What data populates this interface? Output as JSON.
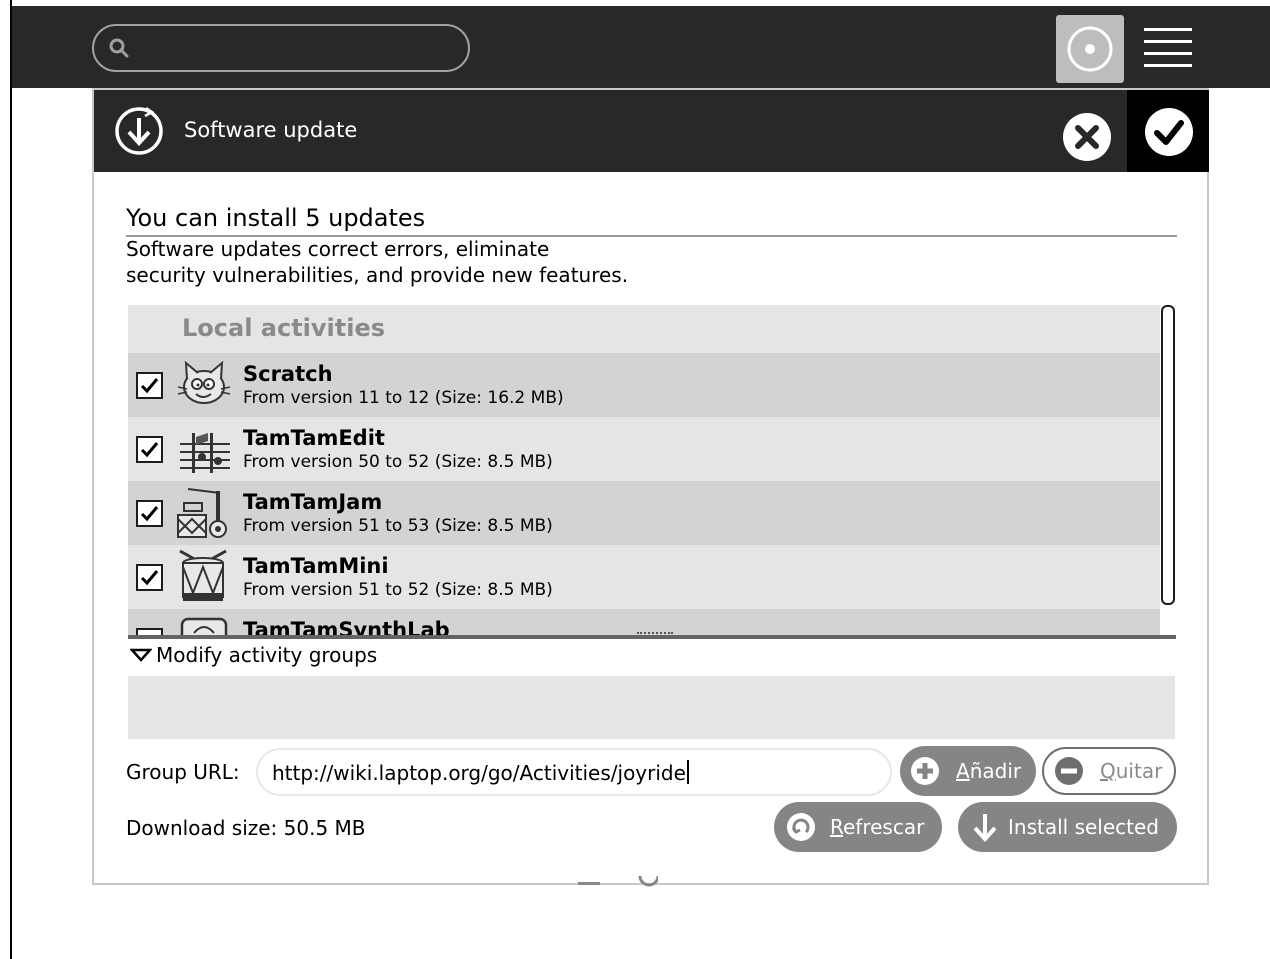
{
  "toolbar": {
    "search_placeholder": "",
    "home_icon": "home-ring-icon",
    "list_icon": "list-view-icon"
  },
  "dialog": {
    "title": "Software update",
    "headline": "You can install 5 updates",
    "description_line1": "Software updates correct errors, eliminate",
    "description_line2": "security vulnerabilities, and provide new features.",
    "group_header": "Local activities",
    "activities": [
      {
        "name": "Scratch",
        "version": "From version 11 to 12 (Size: 16.2 MB)",
        "checked": true
      },
      {
        "name": "TamTamEdit",
        "version": "From version 50 to 52 (Size: 8.5 MB)",
        "checked": true
      },
      {
        "name": "TamTamJam",
        "version": "From version 51 to 53 (Size: 8.5 MB)",
        "checked": true
      },
      {
        "name": "TamTamMini",
        "version": "From version 51 to 52 (Size: 8.5 MB)",
        "checked": true
      },
      {
        "name": "TamTamSynthLab",
        "version": "",
        "checked": false
      }
    ],
    "modify_label": "Modify activity groups",
    "group_url_label": "Group URL:",
    "group_url_value": "http://wiki.laptop.org/go/Activities/joyride",
    "add_button": {
      "prefix": "",
      "underlined": "A",
      "rest": "ñadir"
    },
    "remove_button": {
      "underlined": "Q",
      "rest": "uitar"
    },
    "refresh_button": {
      "underlined": "R",
      "rest": "efrescar"
    },
    "install_button": "Install selected",
    "download_size": "Download size: 50.5 MB"
  },
  "colors": {
    "toolbar_bg": "#282828",
    "header_bg": "#282828",
    "row_dark": "#d3d3d3",
    "row_light": "#e5e5e5",
    "button_bg": "#858585"
  }
}
